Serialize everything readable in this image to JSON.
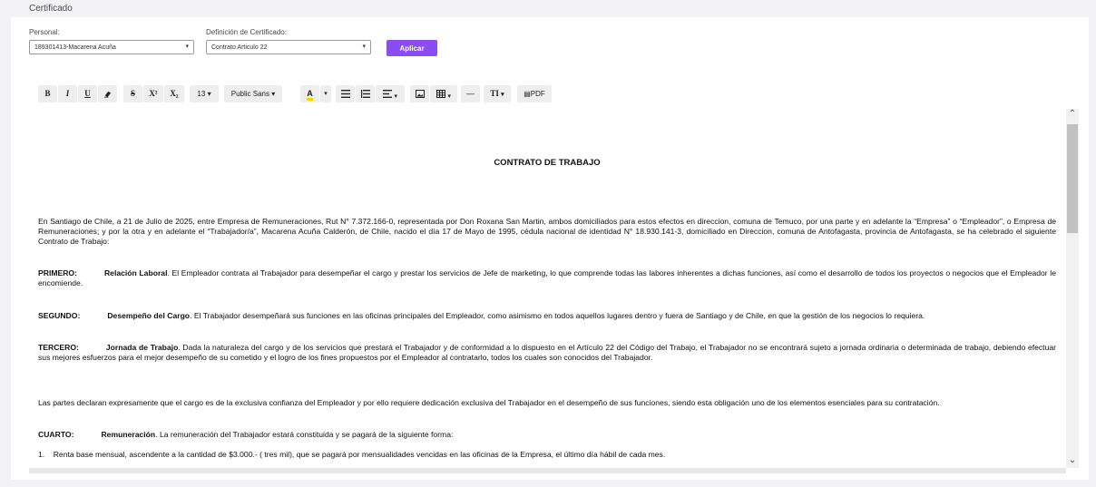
{
  "section": {
    "title": "Certificado"
  },
  "form": {
    "personal_label": "Personal:",
    "personal_value": "189301413-Macarena Acuña",
    "definicion_label": "Definición de Certificado:",
    "definicion_value": "Contrato Articulo 22",
    "apply_label": "Aplicar"
  },
  "toolbar": {
    "bold": "B",
    "italic": "I",
    "underline": "U",
    "strike": "S",
    "superscript": "X²",
    "subscript": "X₂",
    "font_size": "13",
    "font_family": "Public Sans",
    "text_color": "A",
    "text_color_hex": "#f2d600",
    "insert_line": "—",
    "text_style": "TI",
    "pdf": "PDF"
  },
  "document": {
    "title": "CONTRATO DE TRABAJO",
    "intro": "En Santiago de Chile,  a 21 de Julio de 2025, entre Empresa de Remuneraciones,  Rut  N° 7.372.166-0, representada por Don Roxana San Martin, ambos domiciliados para estos efectos en direccion, comuna de Temuco, por una parte y en adelante la “Empresa” o “Empleador”, o Empresa de Remuneraciones; y por la otra y en adelante el “Trabajador/a”, Macarena Acuña Calderón, de Chile, nacido el día 17 de Mayo de 1995, cédula nacional de identidad N° 18.930.141-3, domiciliado en Direccion, comuna de  Antofagasta, provincia de Antofagasta, se ha  celebrado el siguiente Contrato de Trabajo:",
    "primero_label": "PRIMERO:",
    "primero_heading": "Relación Laboral",
    "primero_text": ". El Empleador contrata al Trabajador para desempeñar el cargo y prestar los servicios de Jefe de marketing, lo que comprende todas las labores inherentes a dichas funciones, así como el desarrollo de todos los proyectos o negocios que el Empleador le encomiende.",
    "segundo_label": "SEGUNDO:",
    "segundo_heading": "Desempeño del Cargo",
    "segundo_text": ". El Trabajador desempeñará sus funciones en las oficinas principales del Empleador, como asimismo en todos aquellos lugares dentro y fuera de Santiago y de Chile, en  que la gestión de los negocios lo requiera.",
    "tercero_label": "TERCERO:",
    "tercero_heading": "Jornada de Trabajo",
    "tercero_text": ". Dada la naturaleza del cargo y de los servicios que prestará el Trabajador y de conformidad a lo dispuesto en el Artículo 22 del Código del Trabajo, el Trabajador no se encontrará sujeto a jornada ordinaria o determinada de trabajo, debiendo efectuar sus mejores esfuerzos para el mejor desempeño de su cometido y el logro de los fines propuestos por el Empleador al contratarlo, todos los cuales son conocidos del Trabajador.",
    "partes": "Las partes declaran expresamente que el cargo es de la exclusiva confianza del Empleador y por ello requiere dedicación exclusiva del Trabajador en el desempeño de sus funciones, siendo esta obligación uno de los elementos esenciales para su contratación.",
    "cuarto_label": "CUARTO:",
    "cuarto_heading": "Remuneración",
    "cuarto_text": ". La remuneración del Trabajador estará constituida y se pagará de la siguiente forma:",
    "item1": "1.    Renta base mensual, ascendente a la cantidad de $3.000.- ( tres mil), que se pagará por mensualidades vencidas en las oficinas de la Empresa, el último día hábil de cada mes."
  }
}
